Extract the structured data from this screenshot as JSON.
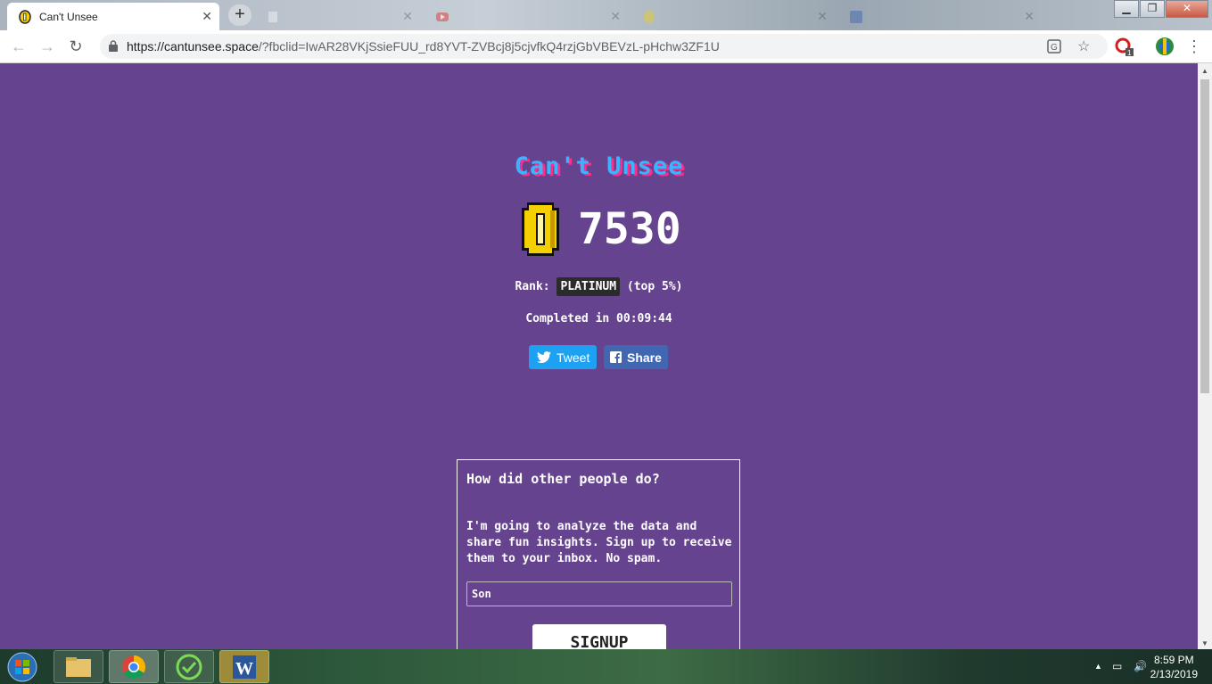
{
  "browser": {
    "tabs": [
      {
        "title": "Can't Unsee",
        "active": true,
        "favicon": "coin-icon"
      },
      {
        "title": "",
        "active": false,
        "favicon": "page-icon"
      },
      {
        "title": "",
        "active": false,
        "favicon": "youtube-icon"
      },
      {
        "title": "",
        "active": false,
        "favicon": "coin-icon"
      },
      {
        "title": "",
        "active": false,
        "favicon": "facebook-icon"
      }
    ],
    "url_host": "https://cantunsee.space",
    "url_rest": "/?fbclid=IwAR28VKjSsieFUU_rd8YVT-ZVBcj8j5cjvfkQ4rzjGbVBEVzL-pHchw3ZF1U",
    "extension_badge": "1"
  },
  "page": {
    "title": "Can't Unsee",
    "score": "7530",
    "rank_label": "Rank:",
    "rank_value": "PLATINUM",
    "rank_percentile": "(top 5%)",
    "completed_text": "Completed in 00:09:44",
    "tweet_label": "Tweet",
    "share_label": "Share",
    "signup": {
      "heading": "How did other people do?",
      "body": "I'm going to analyze the data and share fun insights. Sign up to receive them to your inbox. No spam.",
      "name_value": "Son",
      "button_label": "SIGNUP"
    }
  },
  "taskbar": {
    "time": "8:59 PM",
    "date": "2/13/2019"
  },
  "colors": {
    "page_background": "#65438e",
    "title_blue": "#3db2ff",
    "title_shadow_pink": "#ff2d8a",
    "twitter_blue": "#1da1f2",
    "facebook_blue": "#4267b2",
    "coin_gold": "#f5d000"
  }
}
